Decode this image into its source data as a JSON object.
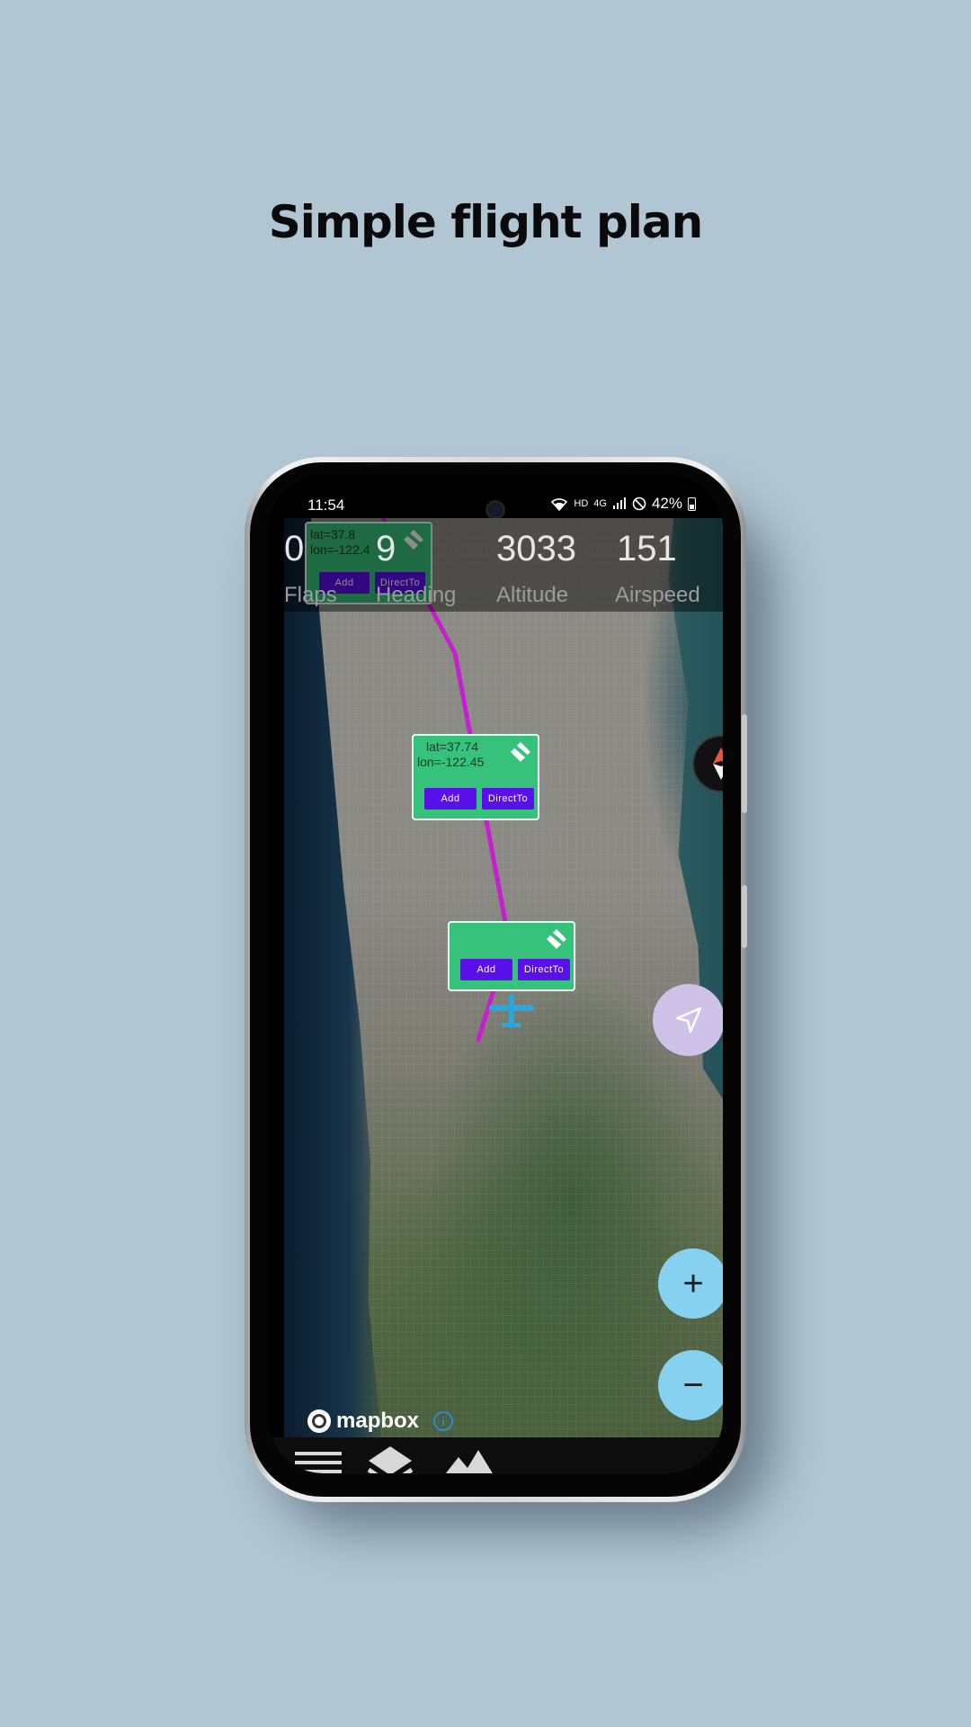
{
  "headline": "Simple flight plan",
  "status_bar": {
    "time": "11:54",
    "network_label": "HD",
    "signal_label": "4G",
    "battery": "42%"
  },
  "instruments": [
    {
      "label": "Flaps",
      "value": "0"
    },
    {
      "label": "Heading",
      "value": "9"
    },
    {
      "label": "Altitude",
      "value": "3033"
    },
    {
      "label": "Airspeed",
      "value": "151"
    }
  ],
  "waypoints": [
    {
      "lat": "lat=37.8",
      "lon": "lon=-122.4",
      "add_label": "Add",
      "direct_label": "DirectTo"
    },
    {
      "lat": "lat=37.74",
      "lon": "lon=-122.45",
      "add_label": "Add",
      "direct_label": "DirectTo"
    },
    {
      "lat": "",
      "lon": "",
      "add_label": "Add",
      "direct_label": "DirectTo"
    }
  ],
  "map": {
    "attribution": "mapbox",
    "info_icon_label": "i",
    "route_color": "#c51fcf",
    "waypoint_color": "#36c27a",
    "button_color": "#5a10e8",
    "plane_color": "#2aa7dd"
  },
  "controls": {
    "compass": "compass-icon",
    "locate": "navigation-arrow-icon",
    "zoom_in": "+",
    "zoom_out": "−"
  },
  "bottom_bar": [
    "menu-icon",
    "layers-icon",
    "terrain-icon"
  ]
}
